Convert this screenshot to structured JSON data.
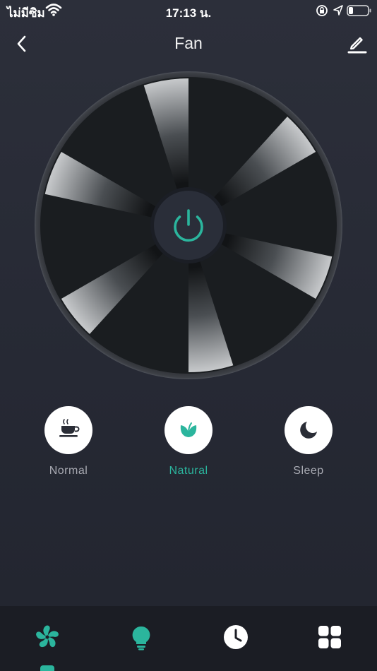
{
  "status_bar": {
    "carrier": "ไม่มีซิม",
    "time": "17:13 น.",
    "wifi_icon": "wifi-icon",
    "lock_icon": "orientation-lock-icon",
    "location_icon": "location-arrow-icon",
    "battery_icon": "battery-icon"
  },
  "header": {
    "title": "Fan",
    "back_icon": "chevron-left-icon",
    "edit_icon": "pencil-icon"
  },
  "fan": {
    "power_icon": "power-icon",
    "accent_color": "#2bb59d"
  },
  "modes": [
    {
      "label": "Normal",
      "icon": "coffee-cup-icon",
      "active": false
    },
    {
      "label": "Natural",
      "icon": "leaf-icon",
      "active": true
    },
    {
      "label": "Sleep",
      "icon": "moon-icon",
      "active": false
    }
  ],
  "tab_bar": {
    "tabs": [
      {
        "icon": "fan-icon",
        "selected": true
      },
      {
        "icon": "light-bulb-icon",
        "selected": false
      },
      {
        "icon": "clock-icon",
        "selected": false
      },
      {
        "icon": "grid-icon",
        "selected": false
      }
    ]
  },
  "colors": {
    "accent": "#2bb59d",
    "background": "#282b36",
    "tab_bar": "#1b1d24",
    "inactive_label": "#a9abb3"
  }
}
